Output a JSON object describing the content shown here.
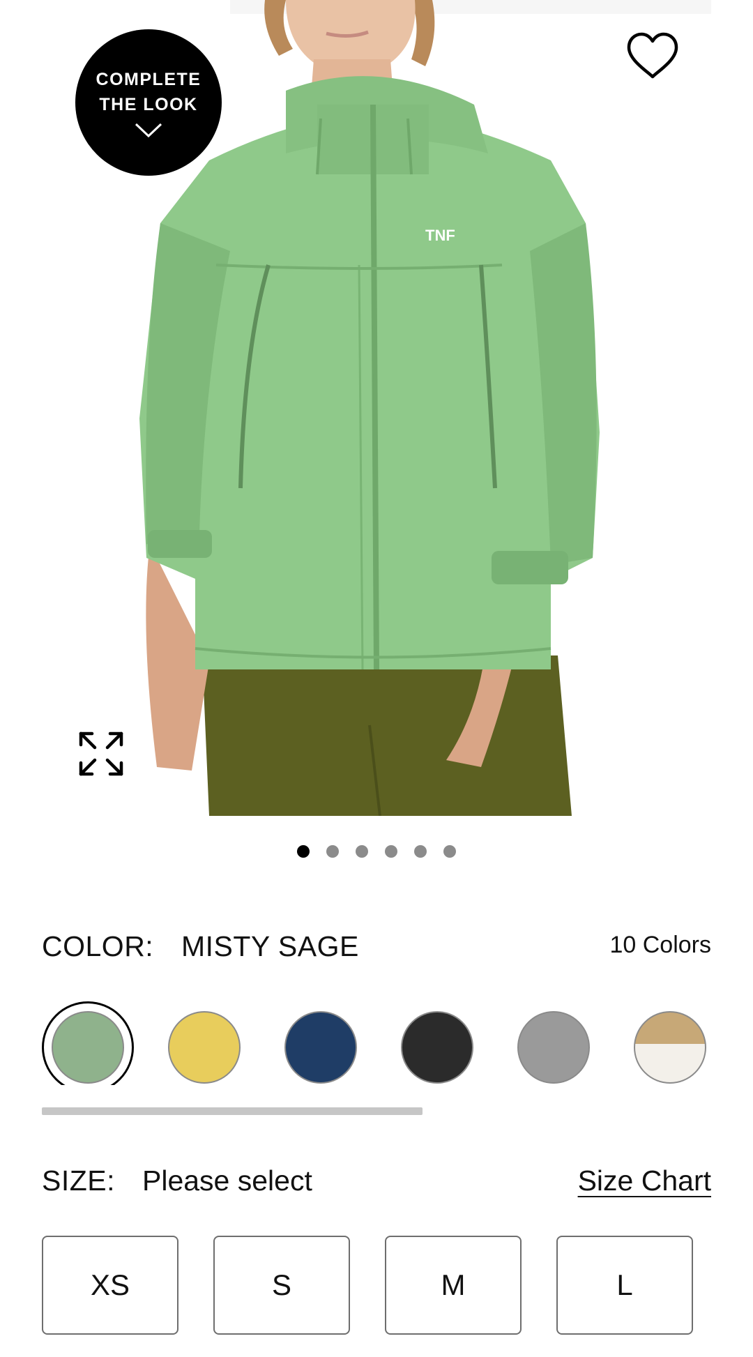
{
  "hero": {
    "badge_line1": "COMPLETE",
    "badge_line2": "THE LOOK",
    "favorite_icon": "heart-outline-icon",
    "expand_icon": "expand-arrows-icon",
    "image_count": 6,
    "active_image": 1
  },
  "color": {
    "label": "COLOR:",
    "selected": "MISTY SAGE",
    "count": "10 Colors",
    "swatches": [
      {
        "color": "#8fb28c",
        "selected": true
      },
      {
        "color": "#e8cd5c",
        "selected": false
      },
      {
        "color": "#1f3d66",
        "selected": false
      },
      {
        "color": "#2b2b2b",
        "selected": false
      },
      {
        "color": "#9a9a9a",
        "selected": false
      },
      {
        "color": "#c7a877",
        "selected": false
      }
    ]
  },
  "size": {
    "label": "SIZE:",
    "value": "Please select",
    "chart_link": "Size Chart",
    "options": [
      "XS",
      "S",
      "M",
      "L"
    ]
  }
}
